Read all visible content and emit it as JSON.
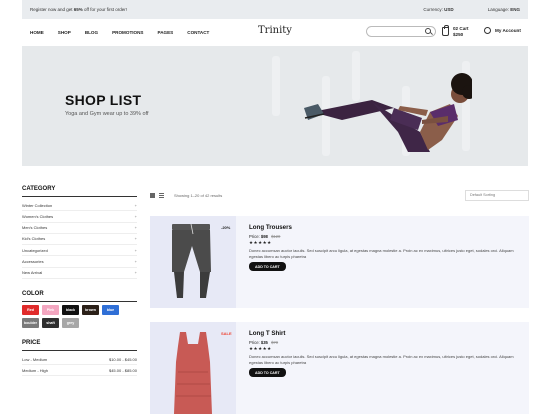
{
  "topbar": {
    "promo_prefix": "Register now and get ",
    "promo_bold": "65%",
    "promo_suffix": " off for your first order!",
    "currency_label": "Currency:",
    "currency_value": "USD",
    "language_label": "Language:",
    "language_value": "ENG"
  },
  "header": {
    "nav": [
      "HOME",
      "SHOP",
      "BLOG",
      "PROMOTIONS",
      "PAGES",
      "CONTACT"
    ],
    "logo": "Trinity",
    "search_placeholder": "",
    "cart_line1": "02 Cart",
    "cart_line2": "$250",
    "account": "My Account"
  },
  "hero": {
    "title": "SHOP LIST",
    "subtitle": "Yoga and Gym wear up to 39% off"
  },
  "sidebar": {
    "category_title": "CATEGORY",
    "categories": [
      "Winter Collection",
      "Women's Clothes",
      "Men's Clothes",
      "Kid's Clothes",
      "Uncategorized",
      "Accessories",
      "New Arrival"
    ],
    "color_title": "COLOR",
    "colors": [
      {
        "name": "Red",
        "hex": "#e02b2b",
        "text_color": "#ffffff"
      },
      {
        "name": "Pink",
        "hex": "#f3a6c0",
        "text_color": "#ffffff"
      },
      {
        "name": "black",
        "hex": "#111111",
        "text_color": "#ffffff"
      },
      {
        "name": "brown",
        "hex": "#2b2018",
        "text_color": "#ffffff"
      },
      {
        "name": "blue",
        "hex": "#2f6fd6",
        "text_color": "#ffffff"
      },
      {
        "name": "boulder",
        "hex": "#7a7a7a",
        "text_color": "#ffffff"
      },
      {
        "name": "shaft",
        "hex": "#2e2e2e",
        "text_color": "#ffffff"
      },
      {
        "name": "grey",
        "hex": "#a7a7a7",
        "text_color": "#ffffff"
      }
    ],
    "price_title": "PRICE",
    "prices": [
      {
        "label": "Low - Medium",
        "range": "$10.00 - $45.00"
      },
      {
        "label": "Medium - High",
        "range": "$45.00 - $85.00"
      }
    ]
  },
  "toolbar": {
    "showing": "Showing 1–20 of 42 results",
    "sort": "Default Sorting"
  },
  "products": [
    {
      "name": "Long Trousers",
      "price_label": "Price:",
      "price": "$98",
      "old_price": "$120",
      "badge": "-20%",
      "stars": "★★★★★",
      "description": "Donec accumsan auctor iaculis. Sed suscipit arcu ligula, at egestas magna molestie a. Proin ac ex maximus, ultrices justo eget, sodales orci. Aliquam egestas libero ac turpis pharetra",
      "button": "ADD TO CART"
    },
    {
      "name": "Long T Shirt",
      "price_label": "Price:",
      "price": "$35",
      "old_price": "$70",
      "badge": "SALE",
      "stars": "★★★★★",
      "description": "Donec accumsan auctor iaculis. Sed suscipit arcu ligula, at egestas magna molestie a. Proin ac ex maximus, ultrices justo eget, sodales orci. Aliquam egestas libero ac turpis pharetra",
      "button": "ADD TO CART"
    }
  ]
}
